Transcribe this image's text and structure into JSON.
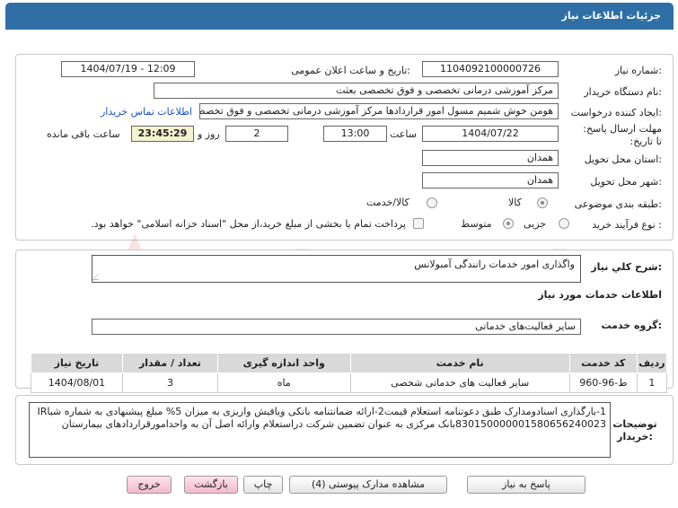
{
  "header": {
    "title": "جزئیات اطلاعات نیاز"
  },
  "form": {
    "need_number": {
      "label": "شماره نیاز:",
      "value": "1104092100000726"
    },
    "announce_datetime": {
      "label": "تاریخ و ساعت اعلان عمومی:",
      "value": "1404/07/19 - 12:09"
    },
    "buyer_org": {
      "label": "نام دستگاه خریدار:",
      "value": "مرکز آموزشی درمانی تخصصی و فوق تخصصی بعثت"
    },
    "requester": {
      "label": "ایجاد کننده درخواست:",
      "value": "هومن خوش شمیم مسول امور قراردادها مرکز آموزشی درمانی تخصصی و فوق تخصصی بعثت"
    },
    "contact_link": "اطلاعات تماس خریدار",
    "deadline": {
      "label": "مهلت ارسال پاسخ: تا تاریخ:",
      "date": "1404/07/22",
      "time_label": "ساعت",
      "time": "13:00",
      "days": "2",
      "days_label": "روز و",
      "remaining": "23:45:29",
      "remaining_label": "ساعت باقی مانده"
    },
    "province": {
      "label": "استان محل تحویل:",
      "value": "همدان"
    },
    "city": {
      "label": "شهر محل تحویل:",
      "value": "همدان"
    },
    "category": {
      "label": "طبقه بندی موضوعی:",
      "options": [
        "کالا",
        "کالا/خدمت"
      ]
    },
    "process": {
      "label": "نوع فرآیند خرید :",
      "options": [
        "جزیی",
        "متوسط"
      ],
      "note": "پرداخت تمام یا بخشی از مبلغ خرید،از محل \"اسناد خزانه اسلامی\" خواهد بود."
    }
  },
  "summary": {
    "label": "شرح کلي نياز:",
    "value": "واگذاری امور خدمات رانندگی آمبولانس"
  },
  "services": {
    "section_title": "اطلاعات خدمات مورد نیاز",
    "group_label": "گروه خدمت:",
    "group_value": "سایر فعالیت‌های خدماتی",
    "table": {
      "headers": [
        "ردیف",
        "کد خدمت",
        "نام خدمت",
        "واحد اندازه گیری",
        "تعداد / مقدار",
        "تاریخ نیاز"
      ],
      "rows": [
        [
          "1",
          "ط-96-960",
          "سایر فعالیت های خدماتی شخصی",
          "ماه",
          "3",
          "1404/08/01"
        ]
      ]
    }
  },
  "buyer_notes": {
    "label": "توضیحات خریدار:",
    "text": "1-بارگذاری اسنادومدارک طبق دعوتنامه استعلام قیمت2-ارائه ضمانتنامه بانکی ویافیش واریزی به میزان 5% مبلغ پیشنهادی به شماره شباIR 830150000001580656240023بانک مرکزی به عنوان تضمین شرکت دراستعلام وارائه اصل آن به واحدامورقراردادهای بیمارستان"
  },
  "buttons": {
    "reply": "پاسخ به نیاز",
    "attachments": "مشاهده مدارک پیوستی (4)",
    "print": "چاپ",
    "back": "بازگشت",
    "exit": "خروج"
  },
  "colors": {
    "header_bg": "#2f6fa6",
    "timer_bg": "#f5f2d0",
    "link": "#1a4fd0",
    "watermark": "#d22c2c"
  }
}
